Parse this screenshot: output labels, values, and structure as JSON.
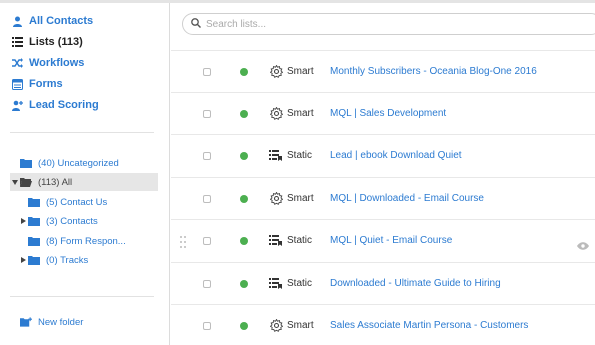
{
  "colors": {
    "link": "#2c7bd1",
    "status_active": "#4caf50"
  },
  "sidebar": {
    "nav": [
      {
        "label": "All Contacts",
        "icon": "person-icon"
      },
      {
        "label": "Lists (113)",
        "icon": "list-icon"
      },
      {
        "label": "Workflows",
        "icon": "shuffle-icon"
      },
      {
        "label": "Forms",
        "icon": "form-icon"
      },
      {
        "label": "Lead Scoring",
        "icon": "person-add-icon"
      }
    ],
    "folders": [
      {
        "label": "(40) Uncategorized"
      },
      {
        "label": "(113) All"
      },
      {
        "label": "(5) Contact Us"
      },
      {
        "label": "(3) Contacts"
      },
      {
        "label": "(8) Form Respon..."
      },
      {
        "label": "(0) Tracks"
      }
    ],
    "new_folder": "New folder"
  },
  "search": {
    "placeholder": "Search lists..."
  },
  "lists": [
    {
      "type": "Smart",
      "name": "Monthly Subscribers - Oceania Blog-One 2016"
    },
    {
      "type": "Smart",
      "name": "MQL | Sales Development"
    },
    {
      "type": "Static",
      "name": "Lead | ebook Download Quiet"
    },
    {
      "type": "Smart",
      "name": "MQL | Downloaded - Email Course"
    },
    {
      "type": "Static",
      "name": "MQL | Quiet - Email Course"
    },
    {
      "type": "Static",
      "name": "Downloaded - Ultimate Guide to Hiring"
    },
    {
      "type": "Smart",
      "name": "Sales Associate Martin Persona - Customers"
    }
  ]
}
